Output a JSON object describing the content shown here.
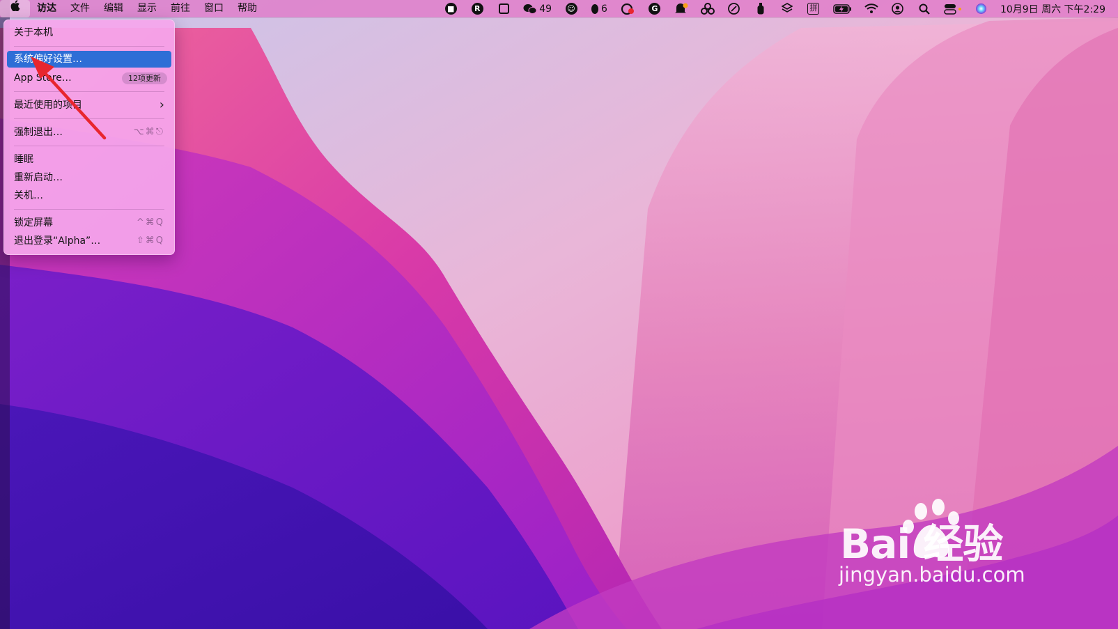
{
  "menubar": {
    "apple_icon": "apple-logo",
    "app_name": "访达",
    "menus": [
      "文件",
      "编辑",
      "显示",
      "前往",
      "窗口",
      "帮助"
    ],
    "status_items": [
      {
        "icon": "record-stop-icon"
      },
      {
        "icon": "r-app-icon",
        "text": "R"
      },
      {
        "icon": "grid-app-icon"
      },
      {
        "icon": "wechat-icon",
        "count": "49"
      },
      {
        "icon": "smile-chat-icon"
      },
      {
        "icon": "qq-penguin-icon",
        "count": "6"
      },
      {
        "icon": "cloud-sync-icon"
      },
      {
        "icon": "g-circle-icon"
      },
      {
        "icon": "notification-bell-icon"
      },
      {
        "icon": "three-circles-icon"
      },
      {
        "icon": "feather-icon"
      },
      {
        "icon": "bottle-icon"
      },
      {
        "icon": "layers-icon"
      },
      {
        "icon": "input-method-icon",
        "text": "拼"
      },
      {
        "icon": "battery-charging-icon"
      },
      {
        "icon": "wifi-icon"
      },
      {
        "icon": "user-account-icon"
      },
      {
        "icon": "spotlight-search-icon"
      },
      {
        "icon": "control-center-icon"
      },
      {
        "icon": "siri-icon"
      }
    ],
    "clock": "10月9日 周六 下午2:29"
  },
  "apple_menu": {
    "about": "关于本机",
    "system_preferences": "系统偏好设置…",
    "app_store": "App Store…",
    "app_store_badge": "12项更新",
    "recent_items": "最近使用的项目",
    "force_quit": "强制退出…",
    "force_quit_shortcut": "⌥⌘⎋",
    "sleep": "睡眠",
    "restart": "重新启动…",
    "shutdown": "关机…",
    "lock_screen": "锁定屏幕",
    "lock_screen_shortcut": "^⌘Q",
    "logout": "退出登录“Alpha”…",
    "logout_shortcut": "⇧⌘Q",
    "highlight_color": "#2e6ed6"
  },
  "watermark": {
    "brand": "Bai 经验",
    "url": "jingyan.baidu.com"
  },
  "colors": {
    "annotation_arrow": "#e8262e",
    "menubar_bg": "#e078c8",
    "menu_bg": "#f5a6ec"
  }
}
